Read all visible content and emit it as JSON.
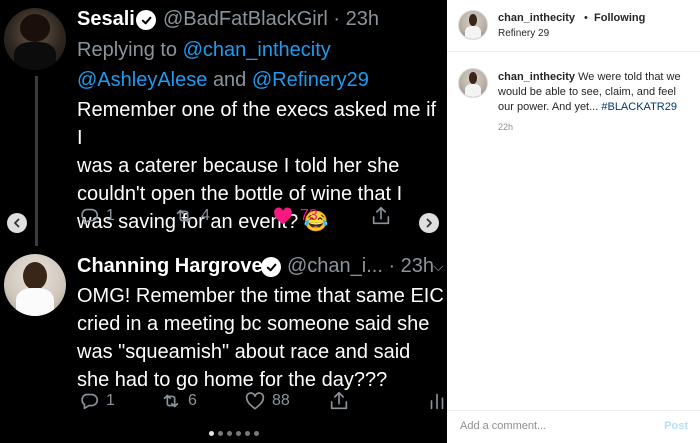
{
  "tweet1": {
    "name": "Sesali",
    "handle": "@BadFatBlackGirl · 23h",
    "replying_prefix": "Replying to",
    "replying_to_1": "@chan_inthecity",
    "replying_to_2": "@AshleyAlese",
    "replying_and": "and",
    "replying_to_3": "@Refinery29",
    "text_lines": [
      "Remember one of the execs asked me if I",
      "was a caterer because I told her she",
      "couldn't open the bottle of wine that I",
      "was saving for an event? 😂"
    ],
    "actions": {
      "reply": "1",
      "retweet": "4",
      "like": "73"
    }
  },
  "tweet2": {
    "name": "Channing Hargrove",
    "handle": "@chan_i... · 23h",
    "text_lines": [
      "OMG! Remember the time that same EIC",
      "cried in a meeting bc someone said she",
      "was \"squeamish\" about race and said",
      "she had to go home for the day???"
    ],
    "actions": {
      "reply": "1",
      "retweet": "6",
      "like": "88"
    }
  },
  "instagram": {
    "username": "chan_inthecity",
    "following": "Following",
    "dot": "•",
    "location": "Refinery 29",
    "caption_user": "chan_inthecity",
    "caption_lines": [
      "We were told that we",
      "would be able to see, claim, and feel",
      "our power. And yet..."
    ],
    "hashtag": "#BLACKATR29",
    "time": "22h",
    "comment_placeholder": "Add a comment...",
    "post_label": "Post"
  },
  "carousel": {
    "slide_count": 6,
    "active_index": 0
  },
  "colors": {
    "twitter_blue": "#1d9bf0",
    "like_pink": "#f91880",
    "secondary_gray": "#8b949c",
    "instagram_link": "#00376b",
    "post_disabled": "#b2dffc"
  }
}
